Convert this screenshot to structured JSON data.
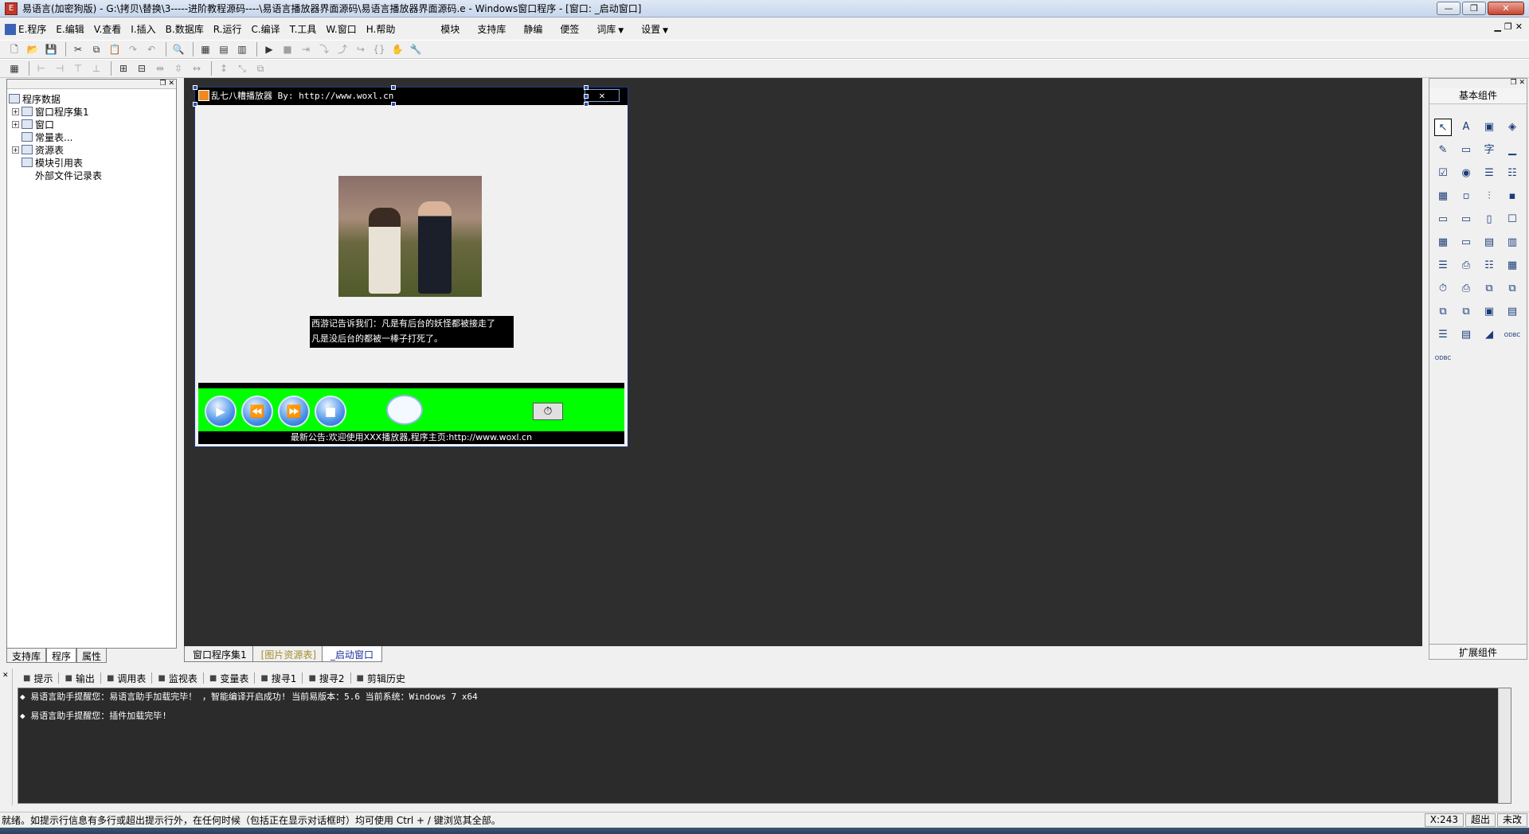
{
  "window": {
    "title": "易语言(加密狗版) - G:\\拷贝\\替换\\3-----进阶教程源码----\\易语言播放器界面源码\\易语言播放器界面源码.e - Windows窗口程序 - [窗口: _启动窗口]",
    "min": "—",
    "max": "❐",
    "close": "✕"
  },
  "menu": {
    "items": [
      "E.程序",
      "E.编辑",
      "V.查看",
      "I.插入",
      "B.数据库",
      "R.运行",
      "C.编译",
      "T.工具",
      "W.窗口",
      "H.帮助"
    ],
    "right_items": [
      "模块",
      "支持库",
      "静编",
      "便签",
      "词库",
      "设置"
    ]
  },
  "left_panel": {
    "tree": [
      {
        "label": "程序数据",
        "level": 0,
        "expand": ""
      },
      {
        "label": "窗口程序集1",
        "level": 1,
        "expand": "+"
      },
      {
        "label": "窗口",
        "level": 1,
        "expand": "+"
      },
      {
        "label": "常量表...",
        "level": 1,
        "expand": ""
      },
      {
        "label": "资源表",
        "level": 1,
        "expand": "+"
      },
      {
        "label": "模块引用表",
        "level": 1,
        "expand": ""
      },
      {
        "label": "外部文件记录表",
        "level": 1,
        "expand": ""
      }
    ],
    "tabs": [
      "支持库",
      "程序",
      "属性"
    ]
  },
  "form": {
    "title": "乱七八糟播放器 By: http://www.woxl.cn",
    "close": "✕",
    "subtitle_line1": "西游记告诉我们：凡是有后台的妖怪都被接走了",
    "subtitle_line2": "凡是没后台的都被一棒子打死了。",
    "notice": "最新公告:欢迎使用XXX播放器,程序主页:http://www.woxl.cn",
    "buttons": [
      "▶",
      "⏪",
      "⏩",
      "■"
    ],
    "timer": "⏱"
  },
  "design_tabs": [
    "窗口程序集1",
    "[图片资源表]",
    "_启动窗口"
  ],
  "right_panel": {
    "header": "基本组件",
    "footer": "扩展组件",
    "icons": [
      "↖",
      "A",
      "▣",
      "◈",
      "✎",
      "▭",
      "字",
      "▁",
      "☑",
      "◉",
      "☰",
      "☷",
      "▦",
      "▫",
      "⫶",
      "▪",
      "▭",
      "▭",
      "▯",
      "☐",
      "▦",
      "▭",
      "▤",
      "▥",
      "☰",
      "⎙",
      "☷",
      "▦",
      "⏱",
      "⎙",
      "⧉",
      "⧉",
      "⧉",
      "⧉",
      "▣",
      "▤",
      "☰",
      "▤",
      "◢",
      "ODBC",
      "ODBC"
    ]
  },
  "bottom_tabs": [
    "提示",
    "输出",
    "调用表",
    "监视表",
    "变量表",
    "搜寻1",
    "搜寻2",
    "剪辑历史"
  ],
  "output_lines": [
    "易语言助手提醒您：易语言助手加载完毕！  ，智能编译开启成功!  当前易版本：5.6  当前系统：Windows 7 x64",
    "易语言助手提醒您：插件加载完毕!"
  ],
  "status": {
    "message": "就绪。如提示行信息有多行或超出提示行外，在任何时候（包括正在显示对话框时）均可使用 Ctrl + / 键浏览其全部。",
    "coord": "X:243",
    "mode": "超出",
    "caps": "未改"
  }
}
